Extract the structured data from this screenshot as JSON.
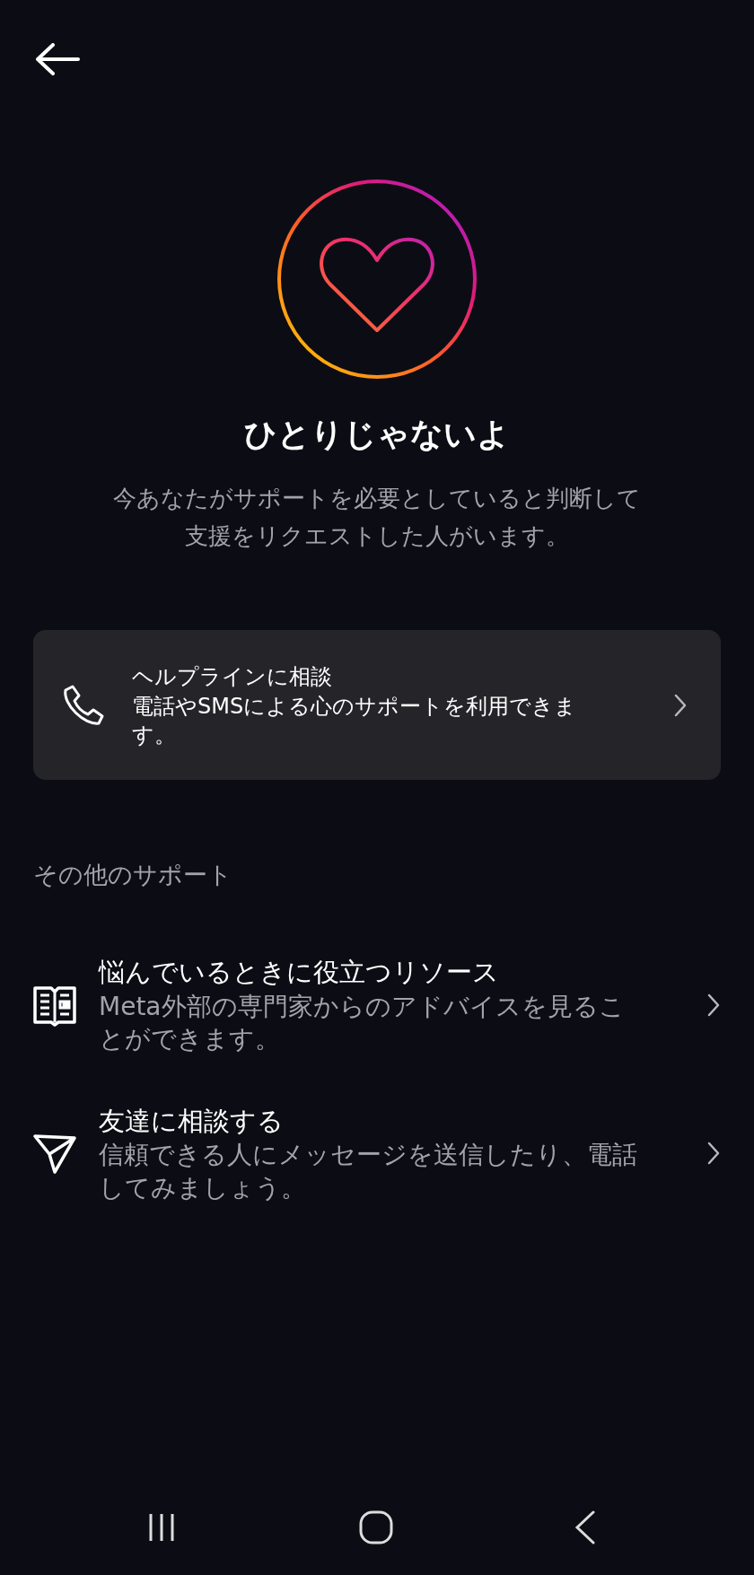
{
  "hero": {
    "title": "ひとりじゃないよ",
    "description": "今あなたがサポートを必要としていると判断して支援をリクエストした人がいます。"
  },
  "helpline_card": {
    "title": "ヘルプラインに相談",
    "description": "電話やSMSによる心のサポートを利用できます。"
  },
  "other_support": {
    "heading": "その他のサポート",
    "items": [
      {
        "kind": "book",
        "title": "悩んでいるときに役立つリソース",
        "description": "Meta外部の専門家からのアドバイスを見ることができます。"
      },
      {
        "kind": "send",
        "title": "友達に相談する",
        "description": "信頼できる人にメッセージを送信したり、電話してみましょう。"
      }
    ]
  }
}
